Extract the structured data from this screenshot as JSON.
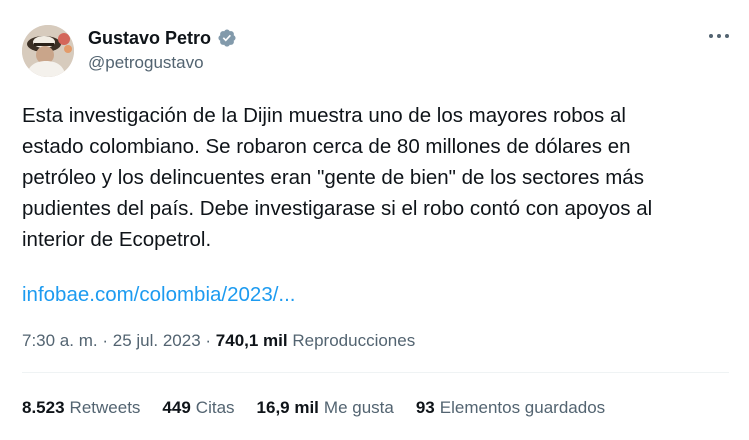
{
  "author": {
    "name": "Gustavo Petro",
    "handle": "@petrogustavo",
    "verified_color": "#829aab"
  },
  "tweet": {
    "lines": [
      "Esta investigación de la Dijin muestra uno de los mayores robos al",
      "estado colombiano. Se robaron cerca de 80 millones de dólares en",
      "petróleo y los delincuentes eran \"gente de bien\" de los sectores más",
      "pudientes del país. Debe investigarase si el robo contó con apoyos al",
      "interior de Ecopetrol."
    ],
    "link": "infobae.com/colombia/2023/...",
    "link_color": "#1d9bf0"
  },
  "meta": {
    "time": "7:30 a. m.",
    "separator": "·",
    "date": "25 jul. 2023",
    "views_count": "740,1 mil",
    "views_label": "Reproducciones"
  },
  "stats": [
    {
      "count": "8.523",
      "label": "Retweets"
    },
    {
      "count": "449",
      "label": "Citas"
    },
    {
      "count": "16,9 mil",
      "label": "Me gusta"
    },
    {
      "count": "93",
      "label": "Elementos guardados"
    }
  ],
  "icons": {
    "more": "more-icon",
    "verified": "verified-badge-icon"
  }
}
